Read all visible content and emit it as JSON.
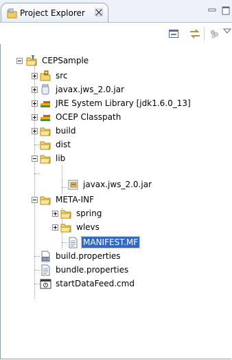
{
  "view": {
    "title": "Project Explorer",
    "close_glyph": "⊠"
  },
  "toolbar": {
    "collapse_all_icon": "collapse-all-icon",
    "link_with_editor_icon": "link-with-editor-icon",
    "view_menu_icon": "view-menu-icon"
  },
  "tree": {
    "project": "CEPSample",
    "items": [
      {
        "label": "src"
      },
      {
        "label": "javax.jws_2.0.jar"
      },
      {
        "label": "JRE System Library [jdk1.6.0_13]"
      },
      {
        "label": "OCEP Classpath"
      },
      {
        "label": "build"
      },
      {
        "label": "dist"
      },
      {
        "label": "lib"
      },
      {
        "label": "javax.jws_2.0.jar"
      },
      {
        "label": "META-INF"
      },
      {
        "label": "spring"
      },
      {
        "label": "wlevs"
      },
      {
        "label": "MANIFEST.MF"
      },
      {
        "label": "build.properties"
      },
      {
        "label": "bundle.properties"
      },
      {
        "label": "startDataFeed.cmd"
      }
    ]
  },
  "colors": {
    "selection": "#3169c6",
    "folder": "#f5d66e",
    "tab_border": "#9aa6bb"
  }
}
